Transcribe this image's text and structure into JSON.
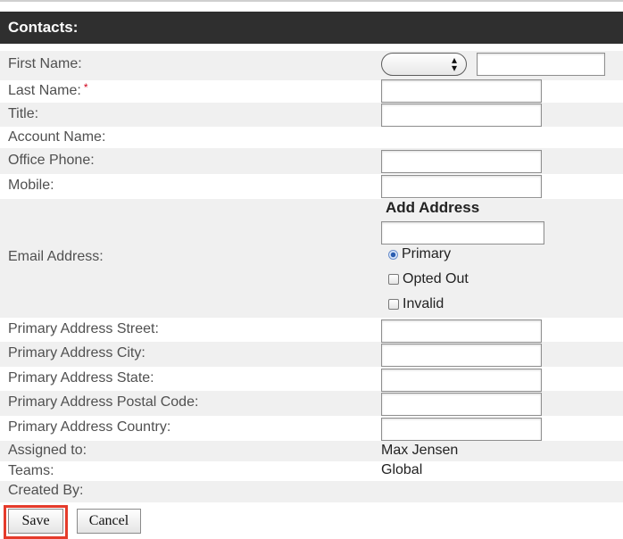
{
  "header": {
    "title": "Contacts:"
  },
  "fields": {
    "first_name": "First Name:",
    "last_name": "Last Name:",
    "required_mark": "*",
    "title": "Title:",
    "account_name": "Account Name:",
    "office_phone": "Office Phone:",
    "mobile": "Mobile:",
    "email_address": "Email Address:",
    "street": "Primary Address Street:",
    "city": "Primary Address City:",
    "state": "Primary Address State:",
    "postal": "Primary Address Postal Code:",
    "country": "Primary Address Country:",
    "assigned_to": "Assigned to:",
    "teams": "Teams:",
    "created_by": "Created By:"
  },
  "values": {
    "assigned_to": "Max Jensen",
    "teams": "Global"
  },
  "email": {
    "add_address": "Add Address",
    "primary": "Primary",
    "opted_out": "Opted Out",
    "invalid": "Invalid"
  },
  "buttons": {
    "save": "Save",
    "cancel": "Cancel"
  },
  "colors": {
    "header_bg": "#2f2f2f",
    "required": "#d0021b",
    "highlight": "#e53b2b"
  }
}
